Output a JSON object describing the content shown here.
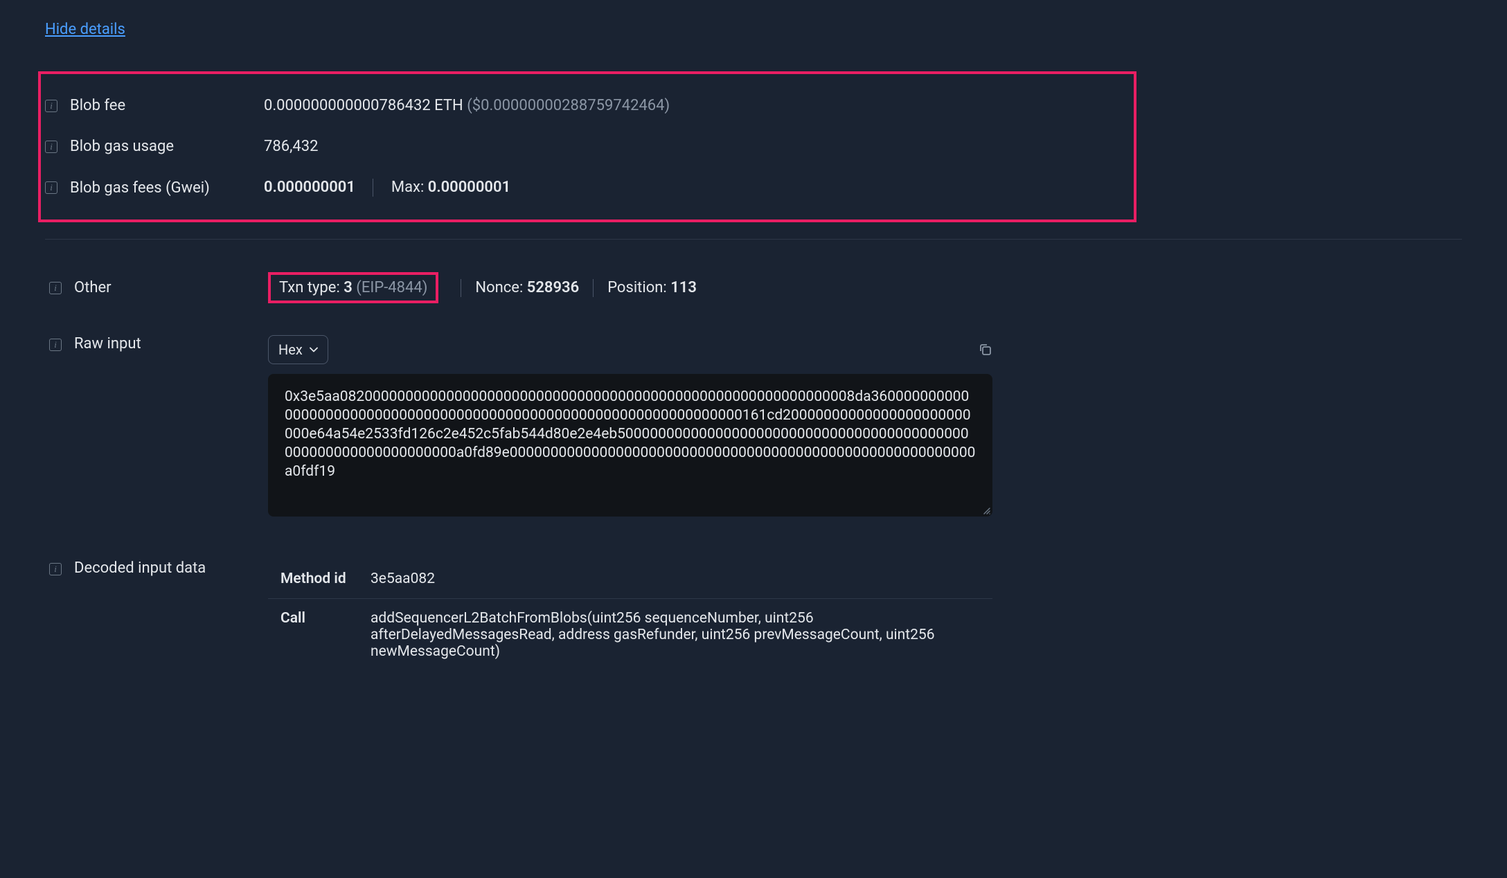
{
  "hideDetails": "Hide details",
  "blobFee": {
    "label": "Blob fee",
    "value": "0.000000000000786432 ETH",
    "usd": "($0.00000000288759742464)"
  },
  "blobGasUsage": {
    "label": "Blob gas usage",
    "value": "786,432"
  },
  "blobGasFees": {
    "label": "Blob gas fees (Gwei)",
    "value": "0.000000001",
    "maxLabel": "Max:",
    "maxValue": "0.00000001"
  },
  "other": {
    "label": "Other",
    "txnTypeLabel": "Txn type:",
    "txnTypeValue": "3",
    "txnTypeExtra": "(EIP-4844)",
    "nonceLabel": "Nonce:",
    "nonceValue": "528936",
    "positionLabel": "Position:",
    "positionValue": "113"
  },
  "rawInput": {
    "label": "Raw input",
    "format": "Hex",
    "hex": "0x3e5aa082000000000000000000000000000000000000000000000000000000000008da36000000000000000000000000000000000000000000000000000000000000000000161cd20000000000000000000000000e64a54e2533fd126c2e452c5fab544d80e2e4eb5000000000000000000000000000000000000000000000000000000000000000a0fd89e000000000000000000000000000000000000000000000000000000000a0fdf19"
  },
  "decodedInput": {
    "label": "Decoded input data",
    "methodIdLabel": "Method id",
    "methodIdValue": "3e5aa082",
    "callLabel": "Call",
    "callValue": "addSequencerL2BatchFromBlobs(uint256 sequenceNumber, uint256 afterDelayedMessagesRead, address gasRefunder, uint256 prevMessageCount, uint256 newMessageCount)"
  }
}
